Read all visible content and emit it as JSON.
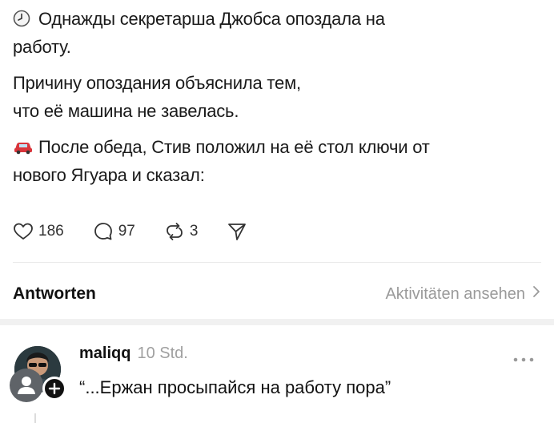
{
  "post": {
    "paragraphs": [
      {
        "icon": "clock-icon",
        "text": "Однажды секретарша Джобса опоздала на работу."
      },
      {
        "icon": "",
        "text": "Причину опоздания объяснила тем, что её машина не завелась."
      },
      {
        "icon": "car-icon",
        "text": "После обеда, Стив положил на её стол ключи от нового Ягуара и сказал:"
      }
    ],
    "line_breaks": {
      "p1_line1": "Однажды секретарша Джобса опоздала на",
      "p1_line2": "работу.",
      "p2_line1": "Причину опоздания объяснила тем,",
      "p2_line2": "что её машина не завелась.",
      "p3_line1": "После обеда, Стив положил на её стол ключи от",
      "p3_line2": "нового Ягуара и сказал:"
    },
    "actions": {
      "likes": "186",
      "comments": "97",
      "reposts": "3"
    }
  },
  "replies_header": {
    "title": "Antworten",
    "activity_link": "Aktivitäten ansehen"
  },
  "reply": {
    "username": "maliqq",
    "timestamp": "10 Std.",
    "text": "“...Ержан просыпайся на работу пора”"
  },
  "colors": {
    "text": "#1a1a1a",
    "muted": "#9a9a9a",
    "divider": "#eaeaea",
    "car_red": "#d9353b"
  }
}
